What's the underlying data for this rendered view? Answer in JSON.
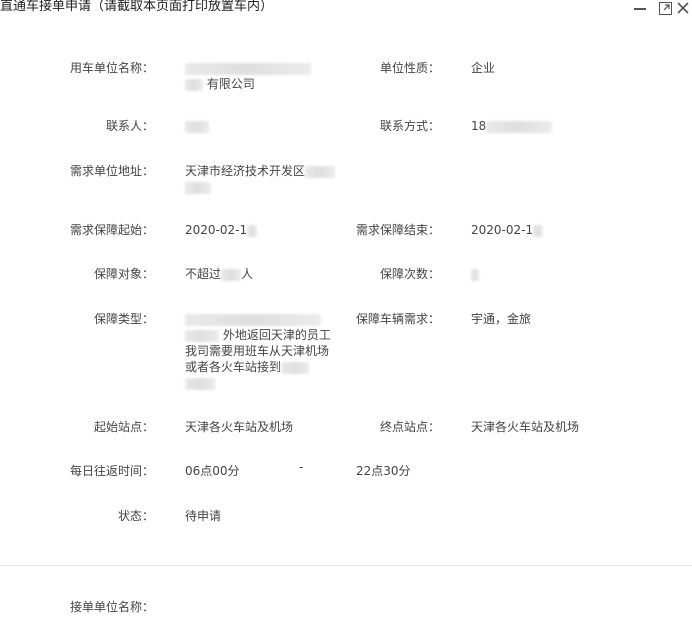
{
  "window": {
    "title": "直通车接单申请（请截取本页面打印放置车内）"
  },
  "form": {
    "unit_name_label": "用车单位名称：",
    "unit_name_value": "有限公司",
    "unit_type_label": "单位性质：",
    "unit_type_value": "企业",
    "contact_label": "联系人：",
    "contact_method_label": "联系方式：",
    "contact_method_value": "18",
    "address_label": "需求单位地址：",
    "address_value": "天津市经济技术开发区",
    "start_label": "需求保障起始：",
    "start_value": "2020-02-1",
    "end_label": "需求保障结束：",
    "end_value": "2020-02-1",
    "target_label": "保障对象：",
    "target_prefix": "不超过",
    "target_suffix": "人",
    "times_label": "保障次数：",
    "type_label": "保障类型：",
    "type_line1": "外地返回天津的员工",
    "type_line2": "我司需要用班车从天津机场",
    "type_line3": "或者各火车站接到",
    "vehicle_label": "保障车辆需求：",
    "vehicle_value": "宇通，金旅",
    "start_station_label": "起始站点：",
    "start_station_value": "天津各火车站及机场",
    "end_station_label": "终点站点：",
    "end_station_value": "天津各火车站及机场",
    "daily_time_label": "每日往返时间：",
    "daily_time_start": "06点00分",
    "daily_time_sep": "-",
    "daily_time_end": "22点30分",
    "status_label": "状态：",
    "status_value": "待申请",
    "accept_unit_label": "接单单位名称："
  },
  "icons": {
    "minimize": "minimize-icon",
    "maximize": "maximize-icon",
    "close": "close-icon"
  }
}
